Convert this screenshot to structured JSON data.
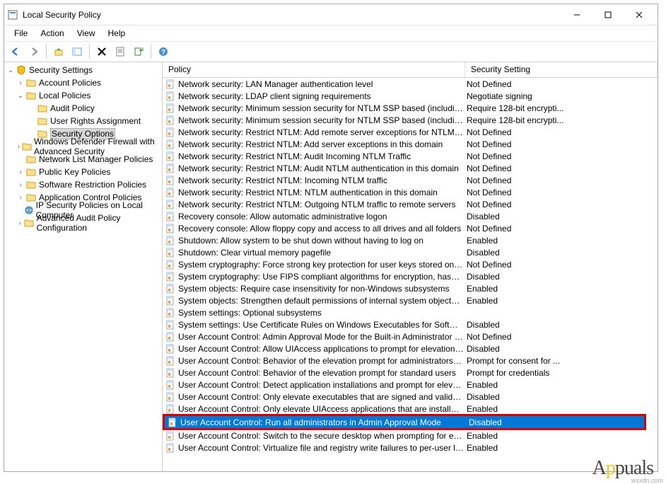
{
  "window_title": "Local Security Policy",
  "menu": {
    "file": "File",
    "action": "Action",
    "view": "View",
    "help": "Help"
  },
  "tree_root": "Security Settings",
  "tree": [
    {
      "label": "Account Policies",
      "expander": "›",
      "indent": 1,
      "icon": "folder"
    },
    {
      "label": "Local Policies",
      "expander": "⌄",
      "indent": 1,
      "icon": "folder"
    },
    {
      "label": "Audit Policy",
      "expander": "",
      "indent": 2,
      "icon": "folder"
    },
    {
      "label": "User Rights Assignment",
      "expander": "",
      "indent": 2,
      "icon": "folder"
    },
    {
      "label": "Security Options",
      "expander": "",
      "indent": 2,
      "icon": "folder",
      "selected": true
    },
    {
      "label": "Windows Defender Firewall with Advanced Security",
      "expander": "›",
      "indent": 1,
      "icon": "folder"
    },
    {
      "label": "Network List Manager Policies",
      "expander": "",
      "indent": 1,
      "icon": "folder"
    },
    {
      "label": "Public Key Policies",
      "expander": "›",
      "indent": 1,
      "icon": "folder"
    },
    {
      "label": "Software Restriction Policies",
      "expander": "›",
      "indent": 1,
      "icon": "folder"
    },
    {
      "label": "Application Control Policies",
      "expander": "›",
      "indent": 1,
      "icon": "folder"
    },
    {
      "label": "IP Security Policies on Local Computer",
      "expander": "",
      "indent": 1,
      "icon": "globe"
    },
    {
      "label": "Advanced Audit Policy Configuration",
      "expander": "›",
      "indent": 1,
      "icon": "folder"
    }
  ],
  "columns": {
    "policy": "Policy",
    "setting": "Security Setting"
  },
  "rows": [
    {
      "p": "Network security: LAN Manager authentication level",
      "s": "Not Defined"
    },
    {
      "p": "Network security: LDAP client signing requirements",
      "s": "Negotiate signing"
    },
    {
      "p": "Network security: Minimum session security for NTLM SSP based (including secure R...",
      "s": "Require 128-bit encrypti..."
    },
    {
      "p": "Network security: Minimum session security for NTLM SSP based (including secure R...",
      "s": "Require 128-bit encrypti..."
    },
    {
      "p": "Network security: Restrict NTLM: Add remote server exceptions for NTLM authenticati...",
      "s": "Not Defined"
    },
    {
      "p": "Network security: Restrict NTLM: Add server exceptions in this domain",
      "s": "Not Defined"
    },
    {
      "p": "Network security: Restrict NTLM: Audit Incoming NTLM Traffic",
      "s": "Not Defined"
    },
    {
      "p": "Network security: Restrict NTLM: Audit NTLM authentication in this domain",
      "s": "Not Defined"
    },
    {
      "p": "Network security: Restrict NTLM: Incoming NTLM traffic",
      "s": "Not Defined"
    },
    {
      "p": "Network security: Restrict NTLM: NTLM authentication in this domain",
      "s": "Not Defined"
    },
    {
      "p": "Network security: Restrict NTLM: Outgoing NTLM traffic to remote servers",
      "s": "Not Defined"
    },
    {
      "p": "Recovery console: Allow automatic administrative logon",
      "s": "Disabled"
    },
    {
      "p": "Recovery console: Allow floppy copy and access to all drives and all folders",
      "s": "Not Defined"
    },
    {
      "p": "Shutdown: Allow system to be shut down without having to log on",
      "s": "Enabled"
    },
    {
      "p": "Shutdown: Clear virtual memory pagefile",
      "s": "Disabled"
    },
    {
      "p": "System cryptography: Force strong key protection for user keys stored on the computer",
      "s": "Not Defined"
    },
    {
      "p": "System cryptography: Use FIPS compliant algorithms for encryption, hashing, and sig...",
      "s": "Disabled"
    },
    {
      "p": "System objects: Require case insensitivity for non-Windows subsystems",
      "s": "Enabled"
    },
    {
      "p": "System objects: Strengthen default permissions of internal system objects (e.g. Symb...",
      "s": "Enabled"
    },
    {
      "p": "System settings: Optional subsystems",
      "s": ""
    },
    {
      "p": "System settings: Use Certificate Rules on Windows Executables for Software Restrictio...",
      "s": "Disabled"
    },
    {
      "p": "User Account Control: Admin Approval Mode for the Built-in Administrator account",
      "s": "Not Defined"
    },
    {
      "p": "User Account Control: Allow UIAccess applications to prompt for elevation without u...",
      "s": "Disabled"
    },
    {
      "p": "User Account Control: Behavior of the elevation prompt for administrators in Admin ...",
      "s": "Prompt for consent for ..."
    },
    {
      "p": "User Account Control: Behavior of the elevation prompt for standard users",
      "s": "Prompt for credentials"
    },
    {
      "p": "User Account Control: Detect application installations and prompt for elevation",
      "s": "Enabled"
    },
    {
      "p": "User Account Control: Only elevate executables that are signed and validated",
      "s": "Disabled"
    },
    {
      "p": "User Account Control: Only elevate UIAccess applications that are installed in secure l...",
      "s": "Enabled"
    },
    {
      "p": "User Account Control: Run all administrators in Admin Approval Mode",
      "s": "Disabled",
      "selected": true,
      "highlight": true
    },
    {
      "p": "User Account Control: Switch to the secure desktop when prompting for elevation",
      "s": "Enabled"
    },
    {
      "p": "User Account Control: Virtualize file and registry write failures to per-user locations",
      "s": "Enabled"
    }
  ],
  "watermark": "Appuals",
  "source_wm": "wsxdn.com"
}
